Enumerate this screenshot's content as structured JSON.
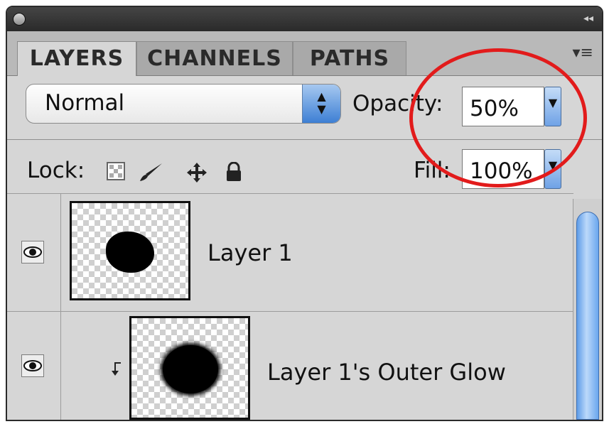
{
  "tabs": [
    {
      "label": "LAYERS",
      "active": true
    },
    {
      "label": "CHANNELS",
      "active": false
    },
    {
      "label": "PATHS",
      "active": false
    }
  ],
  "icons": {
    "panel_menu": "panel-menu-icon",
    "collapse": "collapse-icon",
    "blend_stepper": "up-down-arrows-icon",
    "dropdown": "chevron-down-icon",
    "lock_transparent": "checkerboard-icon",
    "lock_image": "brush-icon",
    "lock_position": "move-arrows-icon",
    "lock_all": "padlock-icon",
    "visibility": "eye-icon",
    "clipping": "clipping-arrow-icon"
  },
  "blend_mode": {
    "value": "Normal"
  },
  "opacity": {
    "label": "Opacity:",
    "value": "50%"
  },
  "lock": {
    "label": "Lock:"
  },
  "fill": {
    "label": "Fill:",
    "value": "100%"
  },
  "layers": [
    {
      "name": "Layer 1",
      "visible": true,
      "clipped": false
    },
    {
      "name": "Layer 1's Outer Glow",
      "visible": true,
      "clipped": true
    }
  ],
  "colors": {
    "highlight_circle": "#e21b1b",
    "accent_blue": "#5e9ce8"
  }
}
